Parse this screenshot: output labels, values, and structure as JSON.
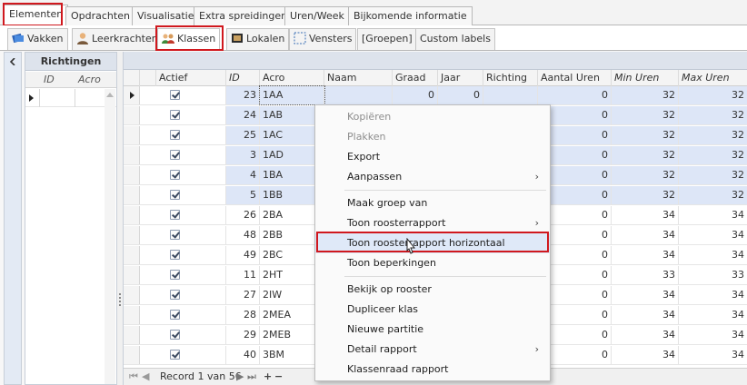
{
  "top_tabs": [
    "Elementen",
    "Opdrachten",
    "Visualisatie",
    "Extra spreidingen",
    "Uren/Week",
    "Bijkomende informatie"
  ],
  "sub_tabs": [
    {
      "label": "Vakken",
      "icon": "books-icon"
    },
    {
      "label": "Leerkrachten",
      "icon": "teacher-icon"
    },
    {
      "label": "Klassen",
      "icon": "class-group-icon"
    },
    {
      "label": "Lokalen",
      "icon": "room-icon"
    },
    {
      "label": "Vensters",
      "icon": "window-icon"
    },
    {
      "label": "[Groepen]",
      "icon": ""
    },
    {
      "label": "Custom labels",
      "icon": ""
    }
  ],
  "left_panel": {
    "title": "Richtingen",
    "columns": [
      "ID",
      "Acro"
    ]
  },
  "grid": {
    "columns": [
      "Actief",
      "ID",
      "Acro",
      "Naam",
      "Graad",
      "Jaar",
      "Richting",
      "Aantal Uren",
      "Min Uren",
      "Max Uren"
    ],
    "rows": [
      {
        "id": "23",
        "acro": "1AA",
        "naam": "",
        "graad": "0",
        "jaar": "0",
        "richting": "",
        "aantal": "0",
        "min": "32",
        "max": "32"
      },
      {
        "id": "24",
        "acro": "1AB",
        "naam": "",
        "graad": "",
        "jaar": "",
        "richting": "",
        "aantal": "0",
        "min": "32",
        "max": "32"
      },
      {
        "id": "25",
        "acro": "1AC",
        "naam": "",
        "graad": "",
        "jaar": "",
        "richting": "",
        "aantal": "0",
        "min": "32",
        "max": "32"
      },
      {
        "id": "3",
        "acro": "1AD",
        "naam": "",
        "graad": "",
        "jaar": "",
        "richting": "",
        "aantal": "0",
        "min": "32",
        "max": "32"
      },
      {
        "id": "4",
        "acro": "1BA",
        "naam": "",
        "graad": "",
        "jaar": "",
        "richting": "",
        "aantal": "0",
        "min": "32",
        "max": "32"
      },
      {
        "id": "5",
        "acro": "1BB",
        "naam": "",
        "graad": "",
        "jaar": "",
        "richting": "",
        "aantal": "0",
        "min": "32",
        "max": "32"
      },
      {
        "id": "26",
        "acro": "2BA",
        "naam": "",
        "graad": "",
        "jaar": "",
        "richting": "",
        "aantal": "0",
        "min": "34",
        "max": "34"
      },
      {
        "id": "48",
        "acro": "2BB",
        "naam": "",
        "graad": "",
        "jaar": "",
        "richting": "",
        "aantal": "0",
        "min": "34",
        "max": "34"
      },
      {
        "id": "49",
        "acro": "2BC",
        "naam": "",
        "graad": "",
        "jaar": "",
        "richting": "",
        "aantal": "0",
        "min": "34",
        "max": "34"
      },
      {
        "id": "11",
        "acro": "2HT",
        "naam": "",
        "graad": "",
        "jaar": "",
        "richting": "",
        "aantal": "0",
        "min": "33",
        "max": "33"
      },
      {
        "id": "27",
        "acro": "2IW",
        "naam": "",
        "graad": "",
        "jaar": "",
        "richting": "",
        "aantal": "0",
        "min": "34",
        "max": "34"
      },
      {
        "id": "28",
        "acro": "2MEA",
        "naam": "",
        "graad": "",
        "jaar": "",
        "richting": "",
        "aantal": "0",
        "min": "34",
        "max": "34"
      },
      {
        "id": "29",
        "acro": "2MEB",
        "naam": "",
        "graad": "",
        "jaar": "",
        "richting": "",
        "aantal": "0",
        "min": "34",
        "max": "34"
      },
      {
        "id": "40",
        "acro": "3BM",
        "naam": "",
        "graad": "",
        "jaar": "",
        "richting": "",
        "aantal": "0",
        "min": "34",
        "max": "34"
      }
    ],
    "selected_count": 6,
    "record_text": "Record 1 van 56"
  },
  "context_menu": {
    "items": [
      {
        "label": "Kopiëren",
        "disabled": true,
        "submenu": false
      },
      {
        "label": "Plakken",
        "disabled": true,
        "submenu": false
      },
      {
        "label": "Export",
        "disabled": false,
        "submenu": false
      },
      {
        "label": "Aanpassen",
        "disabled": false,
        "submenu": true
      },
      {
        "label": "Maak groep van",
        "disabled": false,
        "submenu": false
      },
      {
        "label": "Toon roosterrapport",
        "disabled": false,
        "submenu": true
      },
      {
        "label": "Toon roosterrapport horizontaal",
        "disabled": false,
        "submenu": false
      },
      {
        "label": "Toon beperkingen",
        "disabled": false,
        "submenu": false
      },
      {
        "label": "Bekijk op rooster",
        "disabled": false,
        "submenu": false
      },
      {
        "label": "Dupliceer klas",
        "disabled": false,
        "submenu": false
      },
      {
        "label": "Nieuwe partitie",
        "disabled": false,
        "submenu": false
      },
      {
        "label": "Detail rapport",
        "disabled": false,
        "submenu": true
      },
      {
        "label": "Klassenraad rapport",
        "disabled": false,
        "submenu": false
      }
    ]
  },
  "colors": {
    "highlight_red": "#d0181e",
    "selection_blue": "#dde6f7",
    "panel_header": "#dde3ec"
  }
}
